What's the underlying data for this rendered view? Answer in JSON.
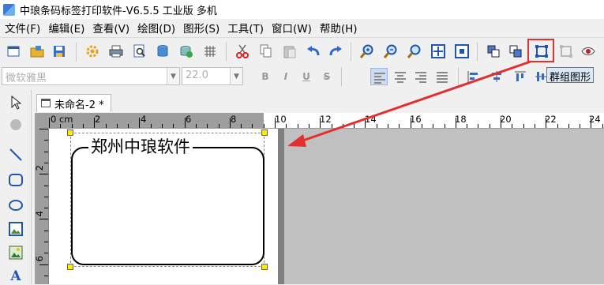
{
  "window": {
    "title": "中琅条码标签打印软件-V6.5.5 工业版 多机"
  },
  "menu": [
    "文件(F)",
    "编辑(E)",
    "查看(V)",
    "绘图(D)",
    "图形(S)",
    "工具(T)",
    "窗口(W)",
    "帮助(H)"
  ],
  "toolbar": {
    "buttons": [
      "new-icon",
      "open-icon",
      "save-icon",
      "settings-icon",
      "print-icon",
      "print-preview-icon",
      "database-icon",
      "data-source-icon",
      "grid-icon",
      "cut-icon",
      "copy-icon",
      "paste-icon",
      "undo-icon",
      "redo-icon",
      "zoom-in-icon",
      "zoom-out-icon",
      "zoom-icon",
      "fit-page-icon",
      "actual-size-icon",
      "bring-front-icon",
      "send-back-icon",
      "group-icon",
      "ungroup-icon",
      "preview-eye-icon"
    ],
    "highlighted": "group-icon"
  },
  "format_bar": {
    "font_name": "微软雅黑",
    "font_size": "22.0",
    "bold": "B",
    "italic": "I",
    "underline": "U",
    "strike": "S"
  },
  "tooltip": "群组图形",
  "tab": {
    "label": "未命名-2 *"
  },
  "ruler": {
    "h_labels": [
      "0 cm",
      "2",
      "4",
      "6",
      "8",
      "10",
      "12",
      "14",
      "16",
      "18",
      "20",
      "22",
      "24"
    ],
    "v_labels": [
      "2",
      "4",
      "6"
    ]
  },
  "label_design": {
    "group_text": "郑州中琅软件"
  },
  "colors": {
    "highlight": "#e23030",
    "arrow": "#e23030",
    "handle": "#ffe800"
  }
}
